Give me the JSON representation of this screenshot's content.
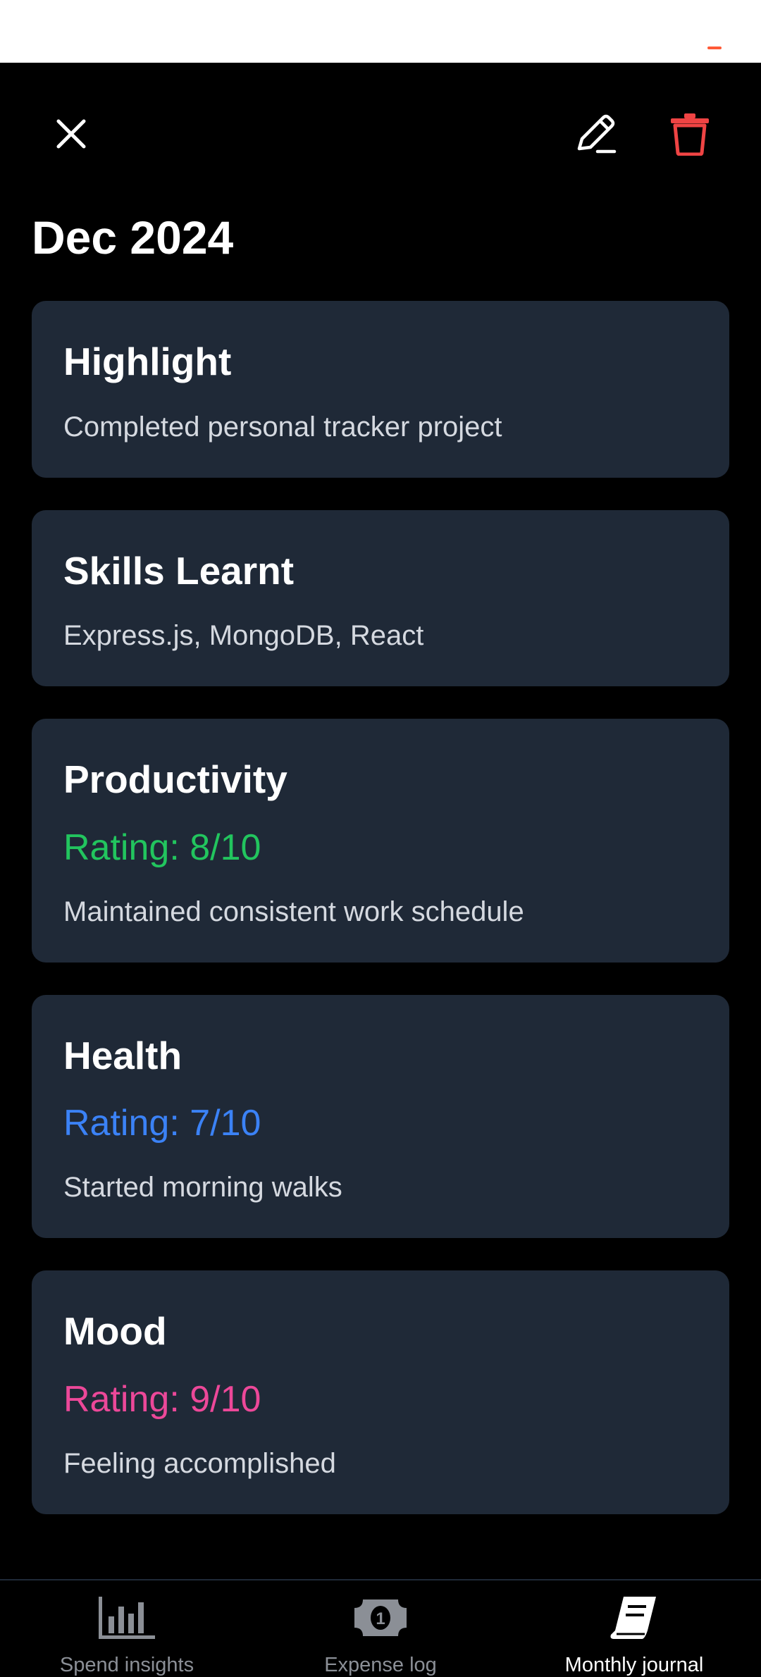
{
  "header": {
    "month_title": "Dec 2024"
  },
  "cards": [
    {
      "title": "Highlight",
      "rating": "",
      "text": "Completed personal tracker project"
    },
    {
      "title": "Skills Learnt",
      "rating": "",
      "text": "Express.js, MongoDB, React"
    },
    {
      "title": "Productivity",
      "rating": "Rating: 8/10",
      "text": "Maintained consistent work schedule",
      "rating_color": "#22c55e"
    },
    {
      "title": "Health",
      "rating": "Rating: 7/10",
      "text": "Started morning walks",
      "rating_color": "#3b82f6"
    },
    {
      "title": "Mood",
      "rating": "Rating: 9/10",
      "text": "Feeling accomplished",
      "rating_color": "#ec4899"
    }
  ],
  "icons": {
    "close": "close-icon",
    "edit": "pencil-icon",
    "delete": "trash-icon"
  },
  "colors": {
    "delete": "#ef4444",
    "card_bg": "#1f2937",
    "accent_orange": "#ff5a36"
  },
  "bottom_nav": {
    "items": [
      {
        "label": "Spend insights",
        "icon": "bar-chart-icon",
        "active": false
      },
      {
        "label": "Expense log",
        "icon": "money-bill-icon",
        "active": false
      },
      {
        "label": "Monthly journal",
        "icon": "book-icon",
        "active": true
      }
    ]
  }
}
